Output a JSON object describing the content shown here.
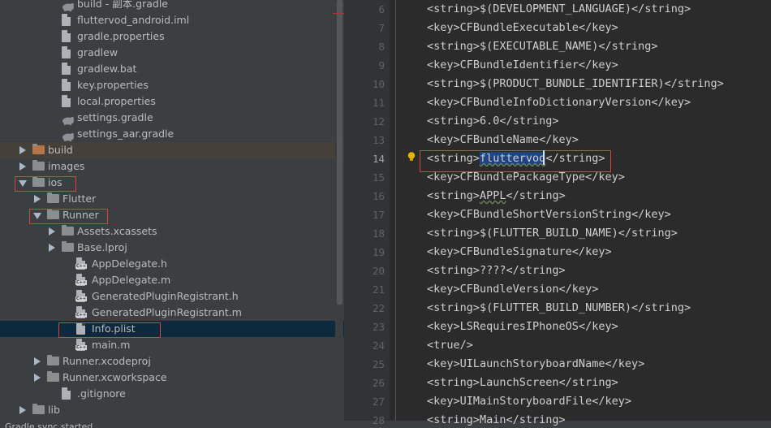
{
  "project_tree": {
    "items": [
      {
        "label": "build - 副本.gradle",
        "kind": "gradle",
        "depth": 3,
        "expand": "none"
      },
      {
        "label": "fluttervod_android.iml",
        "kind": "file",
        "depth": 3,
        "expand": "none"
      },
      {
        "label": "gradle.properties",
        "kind": "file",
        "depth": 3,
        "expand": "none"
      },
      {
        "label": "gradlew",
        "kind": "file",
        "depth": 3,
        "expand": "none"
      },
      {
        "label": "gradlew.bat",
        "kind": "file",
        "depth": 3,
        "expand": "none"
      },
      {
        "label": "key.properties",
        "kind": "file",
        "depth": 3,
        "expand": "none"
      },
      {
        "label": "local.properties",
        "kind": "file",
        "depth": 3,
        "expand": "none"
      },
      {
        "label": "settings.gradle",
        "kind": "gradle",
        "depth": 3,
        "expand": "none"
      },
      {
        "label": "settings_aar.gradle",
        "kind": "gradle",
        "depth": 3,
        "expand": "none"
      },
      {
        "label": "build",
        "kind": "folder",
        "depth": 1,
        "expand": "closed",
        "highlight": "build"
      },
      {
        "label": "images",
        "kind": "folder",
        "depth": 1,
        "expand": "closed"
      },
      {
        "label": "ios",
        "kind": "folder",
        "depth": 1,
        "expand": "open",
        "boxed": true
      },
      {
        "label": "Flutter",
        "kind": "folder",
        "depth": 2,
        "expand": "closed"
      },
      {
        "label": "Runner",
        "kind": "folder",
        "depth": 2,
        "expand": "open",
        "boxed": true
      },
      {
        "label": "Assets.xcassets",
        "kind": "folder",
        "depth": 3,
        "expand": "closed"
      },
      {
        "label": "Base.lproj",
        "kind": "folder",
        "depth": 3,
        "expand": "closed"
      },
      {
        "label": "AppDelegate.h",
        "kind": "cfile",
        "depth": 4,
        "expand": "none"
      },
      {
        "label": "AppDelegate.m",
        "kind": "cfile",
        "depth": 4,
        "expand": "none"
      },
      {
        "label": "GeneratedPluginRegistrant.h",
        "kind": "cfile",
        "depth": 4,
        "expand": "none"
      },
      {
        "label": "GeneratedPluginRegistrant.m",
        "kind": "cfile",
        "depth": 4,
        "expand": "none"
      },
      {
        "label": "Info.plist",
        "kind": "file",
        "depth": 4,
        "expand": "none",
        "selected": true,
        "boxed": true
      },
      {
        "label": "main.m",
        "kind": "cfile",
        "depth": 4,
        "expand": "none"
      },
      {
        "label": "Runner.xcodeproj",
        "kind": "folder",
        "depth": 2,
        "expand": "closed"
      },
      {
        "label": "Runner.xcworkspace",
        "kind": "folder",
        "depth": 2,
        "expand": "closed"
      },
      {
        "label": ".gitignore",
        "kind": "file",
        "depth": 3,
        "expand": "none"
      },
      {
        "label": "lib",
        "kind": "folder",
        "depth": 1,
        "expand": "closed"
      }
    ]
  },
  "editor": {
    "current_line": 14,
    "lines": [
      {
        "n": "6",
        "pre": "<string>$(DEVELOPMENT_LANGUAGE)</string>"
      },
      {
        "n": "7",
        "pre": "<key>CFBundleExecutable</key>"
      },
      {
        "n": "8",
        "pre": "<string>$(EXECUTABLE_NAME)</string>"
      },
      {
        "n": "9",
        "pre": "<key>CFBundleIdentifier</key>"
      },
      {
        "n": "10",
        "pre": "<string>$(PRODUCT_BUNDLE_IDENTIFIER)</string>"
      },
      {
        "n": "11",
        "pre": "<key>CFBundleInfoDictionaryVersion</key>"
      },
      {
        "n": "12",
        "pre": "<string>6.0</string>"
      },
      {
        "n": "13",
        "pre": "<key>CFBundleName</key>"
      },
      {
        "n": "14",
        "pre": "<string>",
        "mark": "fluttervod",
        "post": "</string>",
        "boxed": true
      },
      {
        "n": "15",
        "pre": "<key>CFBundlePackageType</key>"
      },
      {
        "n": "16",
        "pre": "<string>",
        "wavy": "APPL",
        "post": "</string>"
      },
      {
        "n": "17",
        "pre": "<key>CFBundleShortVersionString</key>"
      },
      {
        "n": "18",
        "pre": "<string>$(FLUTTER_BUILD_NAME)</string>"
      },
      {
        "n": "19",
        "pre": "<key>CFBundleSignature</key>"
      },
      {
        "n": "20",
        "pre": "<string>????</string>"
      },
      {
        "n": "21",
        "pre": "<key>CFBundleVersion</key>"
      },
      {
        "n": "22",
        "pre": "<string>$(FLUTTER_BUILD_NUMBER)</string>"
      },
      {
        "n": "23",
        "pre": "<key>LSRequiresIPhoneOS</key>"
      },
      {
        "n": "24",
        "pre": "<true/>"
      },
      {
        "n": "25",
        "pre": "<key>UILaunchStoryboardName</key>"
      },
      {
        "n": "26",
        "pre": "<string>LaunchScreen</string>"
      },
      {
        "n": "27",
        "pre": "<key>UIMainStoryboardFile</key>"
      },
      {
        "n": "28",
        "pre": "<string>Main</string>"
      }
    ]
  },
  "status_bar": {
    "text": "Gradle sync started"
  },
  "colors": {
    "annotation_box": "#e0413f",
    "selection": "#0d293e",
    "panel": "#3c3f41",
    "editor_bg": "#2b2b2b"
  }
}
